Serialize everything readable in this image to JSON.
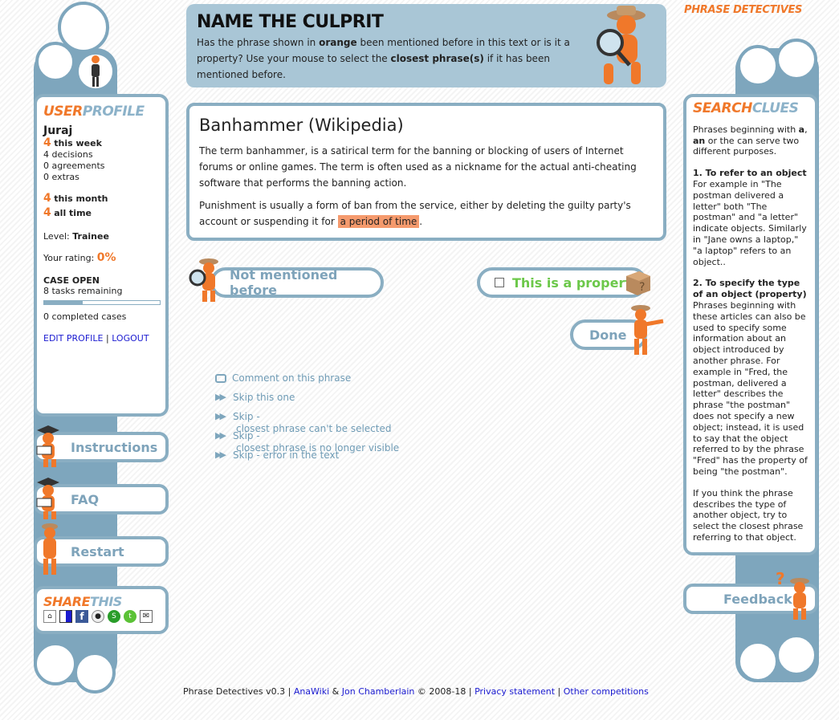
{
  "brand": {
    "logo_text": "PHRASE DETECTIVES"
  },
  "task": {
    "title": "NAME THE CULPRIT",
    "line1_a": "Has the phrase shown in ",
    "line1_b": "orange",
    "line1_c": " been mentioned before in this text or is it a",
    "line2_a": "property? Use your mouse to select the ",
    "line2_b": "closest phrase(s)",
    "line2_c": " if it has been",
    "line3": "mentioned before."
  },
  "document": {
    "title": "Banhammer (Wikipedia)",
    "p1": "The term banhammer, is a satirical term for the banning or blocking of users of Internet forums or online games. The term is often used as a nickname for the actual anti-cheating software that performs the banning action.",
    "p2_a": "Punishment is usually a form of ban from the service, either by deleting the guilty party's account or suspending it for ",
    "p2_highlight": "a period of time",
    "p2_end": "."
  },
  "actions": {
    "not_mentioned": "Not mentioned before",
    "property": "This is a property",
    "done": "Done"
  },
  "links": {
    "comment": "Comment on this phrase",
    "skip_one": "Skip this one",
    "skip_a_1": "Skip -",
    "skip_a_2": "closest phrase can't be selected",
    "skip_b_1": "Skip -",
    "skip_b_2": "closest phrase is no longer visible",
    "skip_c": "Skip - error in the text"
  },
  "user": {
    "section_title_a": "USER",
    "section_title_b": "PROFILE",
    "name": "Juraj",
    "week_count": "4",
    "week_label": "this week",
    "decisions": "4 decisions",
    "agreements": "0 agreements",
    "extras": "0 extras",
    "month_count": "4",
    "month_label": "this month",
    "all_count": "4",
    "all_label": "all time",
    "level_label": "Level: ",
    "level_value": "Trainee",
    "rating_label": "Your rating: ",
    "rating_value": "0%",
    "case_label": "CASE OPEN",
    "tasks_remaining": "8 tasks remaining",
    "case_progress": 0.33,
    "completed": "0 completed cases",
    "edit_profile": "EDIT PROFILE",
    "separator": "|",
    "logout": "LOGOUT"
  },
  "left_nav": {
    "instructions": "Instructions",
    "faq": "FAQ",
    "restart": "Restart"
  },
  "share": {
    "title_a": "SHARE",
    "title_b": "THIS"
  },
  "clues": {
    "title_a": "SEARCH",
    "title_b": "CLUES",
    "intro_a": "Phrases beginning with ",
    "intro_b": "a",
    "intro_c": ", ",
    "intro_d": "an",
    "intro_e": " or the ",
    "intro_f": "the",
    "intro_g": " can serve two different purposes.",
    "h1": "1. To refer to an object",
    "t1": "For example in \"The postman delivered a letter\" both \"The postman\" and \"a letter\" indicate objects. Similarly in \"Jane owns a laptop,\" \"a laptop\" refers to an object..",
    "h2": "2. To specify the type of an object (property)",
    "t2": "Phrases beginning with these articles can also be used to specify some information about an object introduced by another phrase. For example in \"Fred, the postman, delivered a letter\" describes the phrase \"the postman\" does not specify a new object; instead, it is used to say that the object referred to by the phrase \"Fred\" has the property of being \"the postman\".",
    "t3": "If you think the phrase describes the type of another object, try to select the closest phrase referring to that object."
  },
  "feedback": "Feedback",
  "footer": {
    "a": "Phrase Detectives v0.3 | ",
    "anawiki": "AnaWiki",
    "amp": " & ",
    "jon": "Jon Chamberlain",
    "copy": " © 2008-18 | ",
    "privacy": "Privacy statement",
    "sep": " | ",
    "other": "Other competitions"
  },
  "colors": {
    "accent": "#f0782a",
    "frame": "#8aaec2",
    "link": "#6f9bb5",
    "highlight": "#f59a6d"
  }
}
